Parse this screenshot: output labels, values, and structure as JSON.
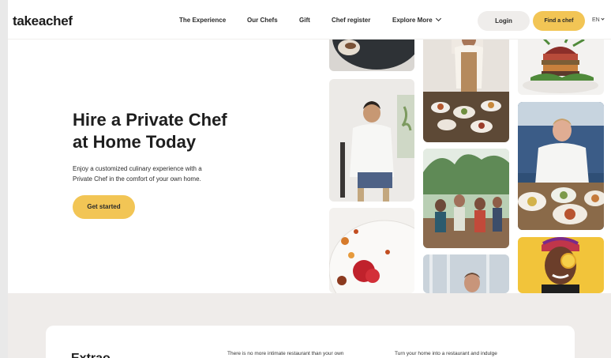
{
  "header": {
    "logo": "takeachef",
    "nav": {
      "experience": "The Experience",
      "chefs": "Our Chefs",
      "gift": "Gift",
      "chef_register": "Chef register",
      "explore_more": "Explore More"
    },
    "login_label": "Login",
    "find_chef_label": "Find a chef",
    "language": "EN"
  },
  "hero": {
    "title_line1": "Hire a Private Chef",
    "title_line2": "at Home Today",
    "description_line1": "Enjoy a customized culinary experience with a",
    "description_line2": "Private Chef in the comfort of your own home.",
    "cta_label": "Get started"
  },
  "bottom": {
    "heading": "Extrao",
    "text1": "There is no more intimate restaurant than your own",
    "text2": "Turn your home into a restaurant and indulge"
  },
  "colors": {
    "accent": "#f2c555",
    "login_bg": "#efedeb",
    "section_bg": "#efecea"
  },
  "icons": {
    "explore_more": "chevron-down-icon",
    "language": "chevron-down-icon"
  }
}
